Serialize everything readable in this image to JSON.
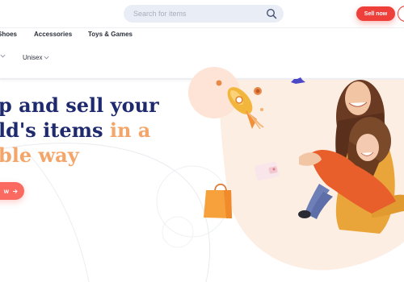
{
  "header": {
    "search": {
      "placeholder": "Search for items",
      "value": ""
    },
    "sell_label": "Sell now"
  },
  "nav": {
    "items": [
      {
        "label": "Shoes"
      },
      {
        "label": "Accessories"
      },
      {
        "label": "Toys & Games"
      }
    ]
  },
  "filters": {
    "items": [
      {
        "label": ""
      },
      {
        "label": "Unisex"
      }
    ]
  },
  "hero": {
    "headline_line1": "p and sell your",
    "headline_line2_main": "ld's items ",
    "headline_line2_accent": "in a",
    "headline_line3_accent": "ble way",
    "cta_label": "w"
  },
  "colors": {
    "brand_red": "#ef3f3a",
    "headline_navy": "#1f2a6e",
    "accent_orange": "#f4a66a",
    "search_bg": "#e9edf5"
  },
  "icons": {
    "search": "search-icon",
    "chevron": "chevron-down-icon",
    "arrow": "arrow-right-icon"
  }
}
